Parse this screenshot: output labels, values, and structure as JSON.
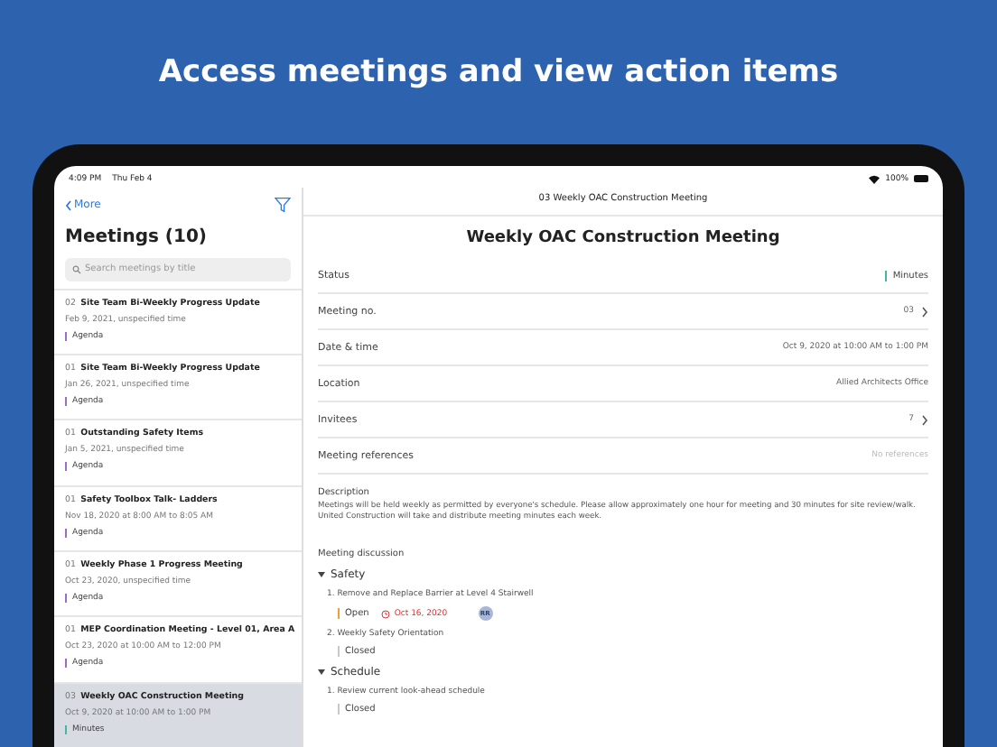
{
  "headline": "Access meetings and view action items",
  "status_bar": {
    "time": "4:09 PM",
    "date": "Thu Feb 4",
    "battery": "100%"
  },
  "sidebar": {
    "back": "More",
    "title": "Meetings (10)",
    "search": {
      "placeholder": "Search meetings by title"
    },
    "items": [
      {
        "number": "02",
        "title": "Site Team Bi-Weekly Progress Update",
        "when": "Feb 9, 2021, unspecified time",
        "status": "Agenda",
        "color": "#9b6cc9",
        "selected": false
      },
      {
        "number": "01",
        "title": "Site Team Bi-Weekly Progress Update",
        "when": "Jan 26, 2021, unspecified time",
        "status": "Agenda",
        "color": "#9b6cc9",
        "selected": false
      },
      {
        "number": "01",
        "title": "Outstanding Safety Items",
        "when": "Jan 5, 2021, unspecified time",
        "status": "Agenda",
        "color": "#9b6cc9",
        "selected": false
      },
      {
        "number": "01",
        "title": "Safety Toolbox Talk- Ladders",
        "when": "Nov 18, 2020 at 8:00 AM to 8:05 AM",
        "status": "Agenda",
        "color": "#9b6cc9",
        "selected": false
      },
      {
        "number": "01",
        "title": "Weekly Phase 1 Progress Meeting",
        "when": "Oct 23, 2020, unspecified time",
        "status": "Agenda",
        "color": "#9b6cc9",
        "selected": false
      },
      {
        "number": "01",
        "title": "MEP Coordination Meeting - Level 01, Area A",
        "when": "Oct 23, 2020 at 10:00 AM to 12:00 PM",
        "status": "Agenda",
        "color": "#9b6cc9",
        "selected": false
      },
      {
        "number": "03",
        "title": "Weekly OAC Construction Meeting",
        "when": "Oct 9, 2020 at 10:00 AM to 1:00 PM",
        "status": "Minutes",
        "color": "#3fb8a8",
        "selected": true
      }
    ]
  },
  "detail": {
    "nav_title": "03 Weekly OAC Construction Meeting",
    "title": "Weekly OAC Construction Meeting",
    "fields": [
      {
        "label": "Status",
        "value": "Minutes",
        "kind": "status",
        "color": "#3fb8a8"
      },
      {
        "label": "Meeting no.",
        "value": "03",
        "kind": "link"
      },
      {
        "label": "Date & time",
        "value": "Oct 9, 2020 at 10:00 AM to 1:00 PM",
        "kind": "text"
      },
      {
        "label": "Location",
        "value": "Allied Architects Office",
        "kind": "text"
      },
      {
        "label": "Invitees",
        "value": "7",
        "kind": "link"
      },
      {
        "label": "Meeting references",
        "value": "No references",
        "kind": "muted"
      }
    ],
    "description": {
      "label": "Description",
      "text": "Meetings will be held weekly as permitted by everyone's schedule. Please allow approximately one hour for meeting and 30 minutes for site review/walk. United Construction will take and distribute meeting minutes each week."
    },
    "discussion": {
      "label": "Meeting discussion",
      "sections": [
        {
          "title": "Safety",
          "expanded": true,
          "items": [
            {
              "number": "1.",
              "title": "Remove and Replace Barrier at Level 4 Stairwell",
              "status": "Open",
              "color": "#f0a030",
              "due": "Oct 16, 2020",
              "assignee": "RR"
            },
            {
              "number": "2.",
              "title": "Weekly Safety Orientation",
              "status": "Closed",
              "color": "#c8c8c8"
            }
          ]
        },
        {
          "title": "Schedule",
          "expanded": true,
          "items": [
            {
              "number": "1.",
              "title": "Review current look-ahead schedule",
              "status": "Closed",
              "color": "#c8c8c8"
            }
          ]
        }
      ]
    }
  }
}
